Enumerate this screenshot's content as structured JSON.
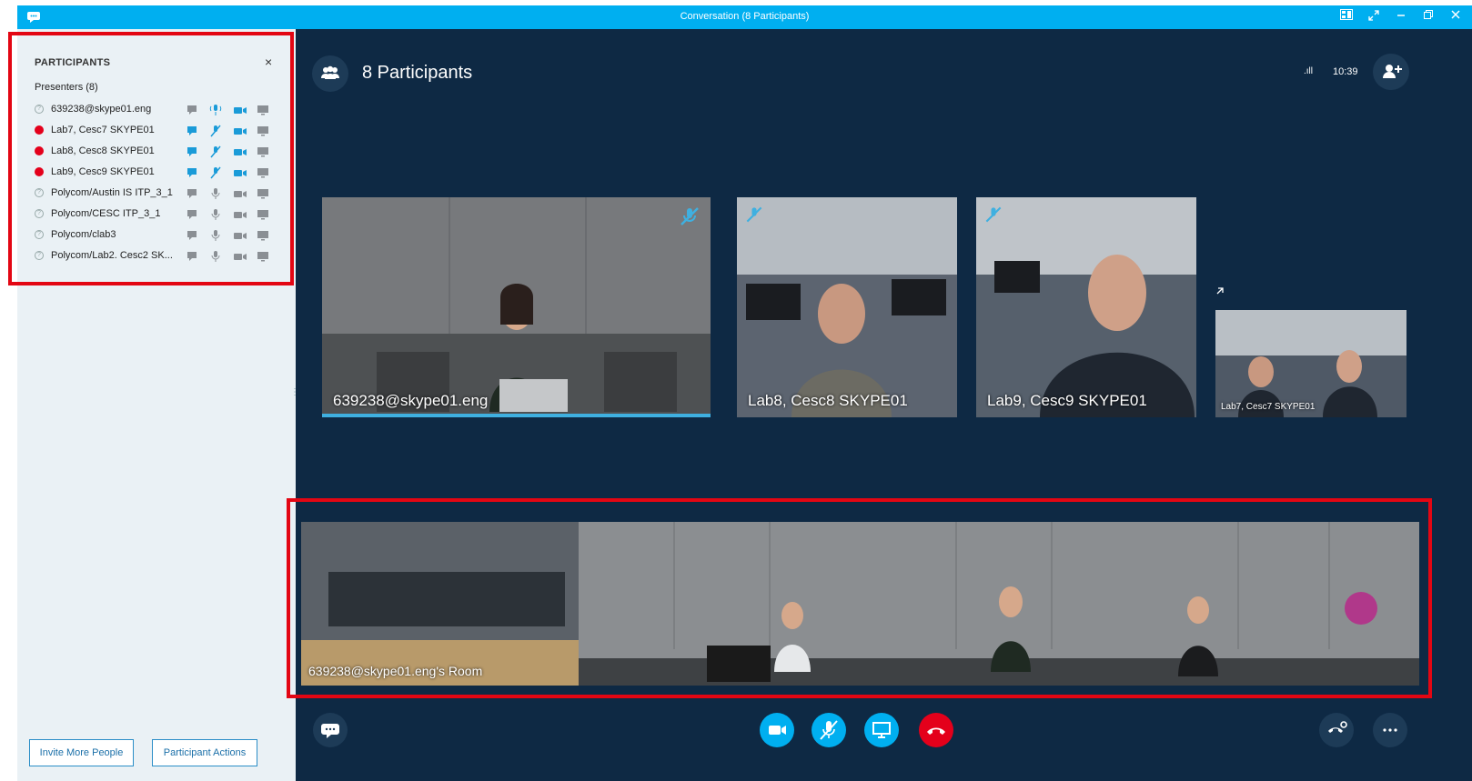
{
  "window": {
    "title": "Conversation (8 Participants)"
  },
  "participants_panel": {
    "heading": "PARTICIPANTS",
    "close_glyph": "×",
    "group_label": "Presenters (8)",
    "participants": [
      {
        "name": "639238@skype01.eng",
        "status": "unknown",
        "im_active": false,
        "audio": "speaking",
        "video_active": true
      },
      {
        "name": "Lab7, Cesc7 SKYPE01",
        "status": "busy",
        "im_active": true,
        "audio": "muted",
        "video_active": true
      },
      {
        "name": "Lab8, Cesc8 SKYPE01",
        "status": "busy",
        "im_active": true,
        "audio": "muted",
        "video_active": true
      },
      {
        "name": "Lab9, Cesc9 SKYPE01",
        "status": "busy",
        "im_active": true,
        "audio": "muted",
        "video_active": true
      },
      {
        "name": "Polycom/Austin IS ITP_3_1",
        "status": "unknown",
        "im_active": false,
        "audio": "idle",
        "video_active": false
      },
      {
        "name": "Polycom/CESC ITP_3_1",
        "status": "unknown",
        "im_active": false,
        "audio": "idle",
        "video_active": false
      },
      {
        "name": "Polycom/clab3",
        "status": "unknown",
        "im_active": false,
        "audio": "idle",
        "video_active": false
      },
      {
        "name": "Polycom/Lab2. Cesc2 SK...",
        "status": "unknown",
        "im_active": false,
        "audio": "idle",
        "video_active": false
      }
    ],
    "invite_button": "Invite More People",
    "actions_button": "Participant Actions"
  },
  "stage": {
    "title": "8 Participants",
    "signal_glyph": ".ıll",
    "time": "10:39",
    "tiles": [
      {
        "label": "639238@skype01.eng",
        "muted": true
      },
      {
        "label": "Lab8, Cesc8 SKYPE01",
        "muted": true
      },
      {
        "label": "Lab9, Cesc9 SKYPE01",
        "muted": true
      },
      {
        "label": "Lab7, Cesc7 SKYPE01",
        "muted": false
      }
    ],
    "room_label": "639238@skype01.eng's Room"
  },
  "colors": {
    "accent": "#00aff0",
    "hangup": "#e4001b",
    "stage_bg": "#0e2944",
    "highlight": "#e30613"
  },
  "icons": [
    "chat-icon",
    "people-icon",
    "add-person-icon",
    "video-icon",
    "mic-muted-icon",
    "screen-share-icon",
    "hang-up-icon",
    "call-controls-icon",
    "more-icon",
    "pop-out-icon"
  ]
}
